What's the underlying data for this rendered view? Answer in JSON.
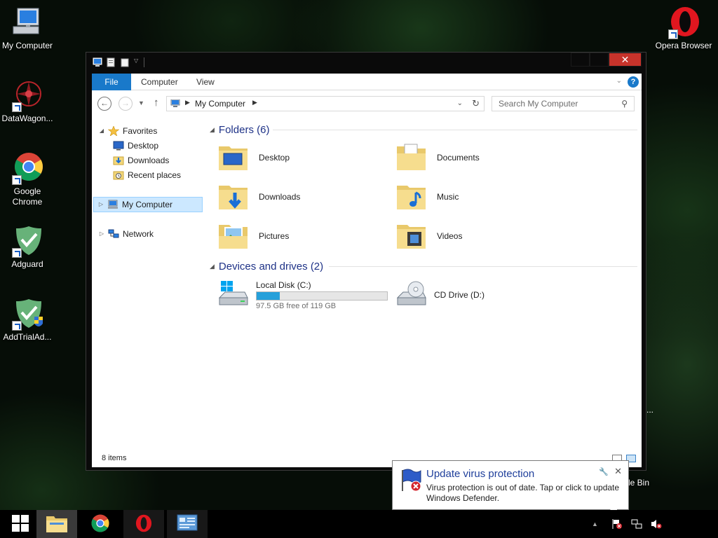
{
  "desktop": {
    "icons_left": [
      {
        "label": "My Computer",
        "icon": "computer-icon"
      },
      {
        "label": "DataWagon...",
        "icon": "datawagon-icon"
      },
      {
        "label": "Google Chrome",
        "icon": "chrome-icon"
      },
      {
        "label": "Adguard",
        "icon": "adguard-icon"
      },
      {
        "label": "AddTrialAd...",
        "icon": "addtrial-icon"
      }
    ],
    "icons_right": [
      {
        "label": "Opera Browser",
        "icon": "opera-icon"
      }
    ],
    "partial_labels": {
      "recycle": "le Bin",
      "dots": "..."
    }
  },
  "window": {
    "ribbon_tabs": [
      "File",
      "Computer",
      "View"
    ],
    "address": {
      "crumb": "My Computer"
    },
    "search": {
      "placeholder": "Search My Computer"
    },
    "nav_pane": {
      "favorites": "Favorites",
      "favorites_items": [
        "Desktop",
        "Downloads",
        "Recent places"
      ],
      "my_computer": "My Computer",
      "network": "Network"
    },
    "folders_group": {
      "title": "Folders (6)"
    },
    "folders": [
      "Desktop",
      "Documents",
      "Downloads",
      "Music",
      "Pictures",
      "Videos"
    ],
    "devices_group": {
      "title": "Devices and drives (2)"
    },
    "drives": [
      {
        "name": "Local Disk (C:)",
        "free_text": "97.5 GB free of 119 GB",
        "used_fraction": 0.18
      },
      {
        "name": "CD Drive (D:)"
      }
    ],
    "status": {
      "item_count": "8 items"
    }
  },
  "notification": {
    "title": "Update virus protection",
    "body": "Virus protection is out of date. Tap or click to update Windows Defender."
  },
  "taskbar": {
    "apps": [
      "start-icon",
      "file-explorer-icon",
      "chrome-icon",
      "opera-icon",
      "control-panel-icon"
    ]
  },
  "colors": {
    "accent": "#1979ca",
    "drive_fill": "#26a0da",
    "close_button": "#c7332b",
    "group_title": "#1e3287"
  }
}
